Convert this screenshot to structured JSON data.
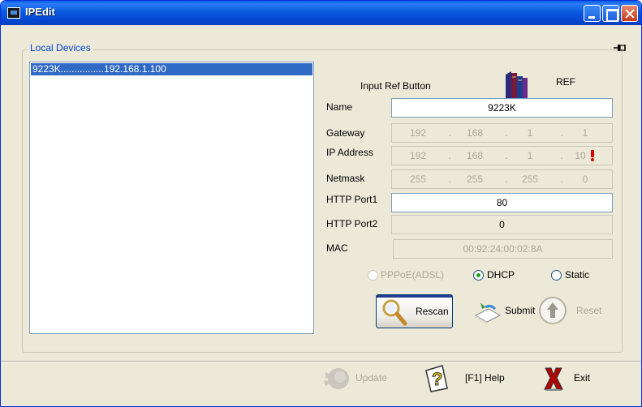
{
  "window": {
    "title": "IPEdit"
  },
  "group": {
    "label": "Local Devices"
  },
  "devices": [
    {
      "label": "9223K................192.168.1.100"
    }
  ],
  "form": {
    "ref_hint": "Input Ref Button",
    "ref_label": "REF",
    "name_label": "Name",
    "name_value": "9223K",
    "gateway_label": "Gateway",
    "gateway": [
      "192",
      "168",
      "1",
      "1"
    ],
    "ip_label": "IP Address",
    "ip": [
      "192",
      "168",
      "1",
      "10"
    ],
    "netmask_label": "Netmask",
    "netmask": [
      "255",
      "255",
      "255",
      "0"
    ],
    "port1_label": "HTTP Port1",
    "port1_value": "80",
    "port2_label": "HTTP Port2",
    "port2_value": "0",
    "mac_label": "MAC",
    "mac_value": "00:92:24:00:02:8A",
    "mode_options": [
      "PPPoE(ADSL)",
      "DHCP",
      "Static"
    ],
    "mode_selected": "DHCP",
    "rescan_label": "Rescan",
    "submit_label": "Submit",
    "reset_label": "Reset"
  },
  "footer": {
    "update_label": "Update",
    "help_label": "[F1] Help",
    "exit_label": "Exit"
  },
  "icons": {
    "app": "app-icon",
    "pin": "pin-icon",
    "ref": "books-icon",
    "rescan": "magnifier-icon",
    "submit": "submit-icon",
    "reset": "up-arrow-icon",
    "update": "update-icon",
    "help": "help-icon",
    "exit": "exit-icon",
    "warning": "warning-icon"
  },
  "colors": {
    "title_bar": "#0A5AE0",
    "selection": "#316AC5",
    "group_label": "#0046D5",
    "face": "#ECE9D8",
    "dhcp_dot": "#21A121",
    "warning": "#E00000"
  }
}
